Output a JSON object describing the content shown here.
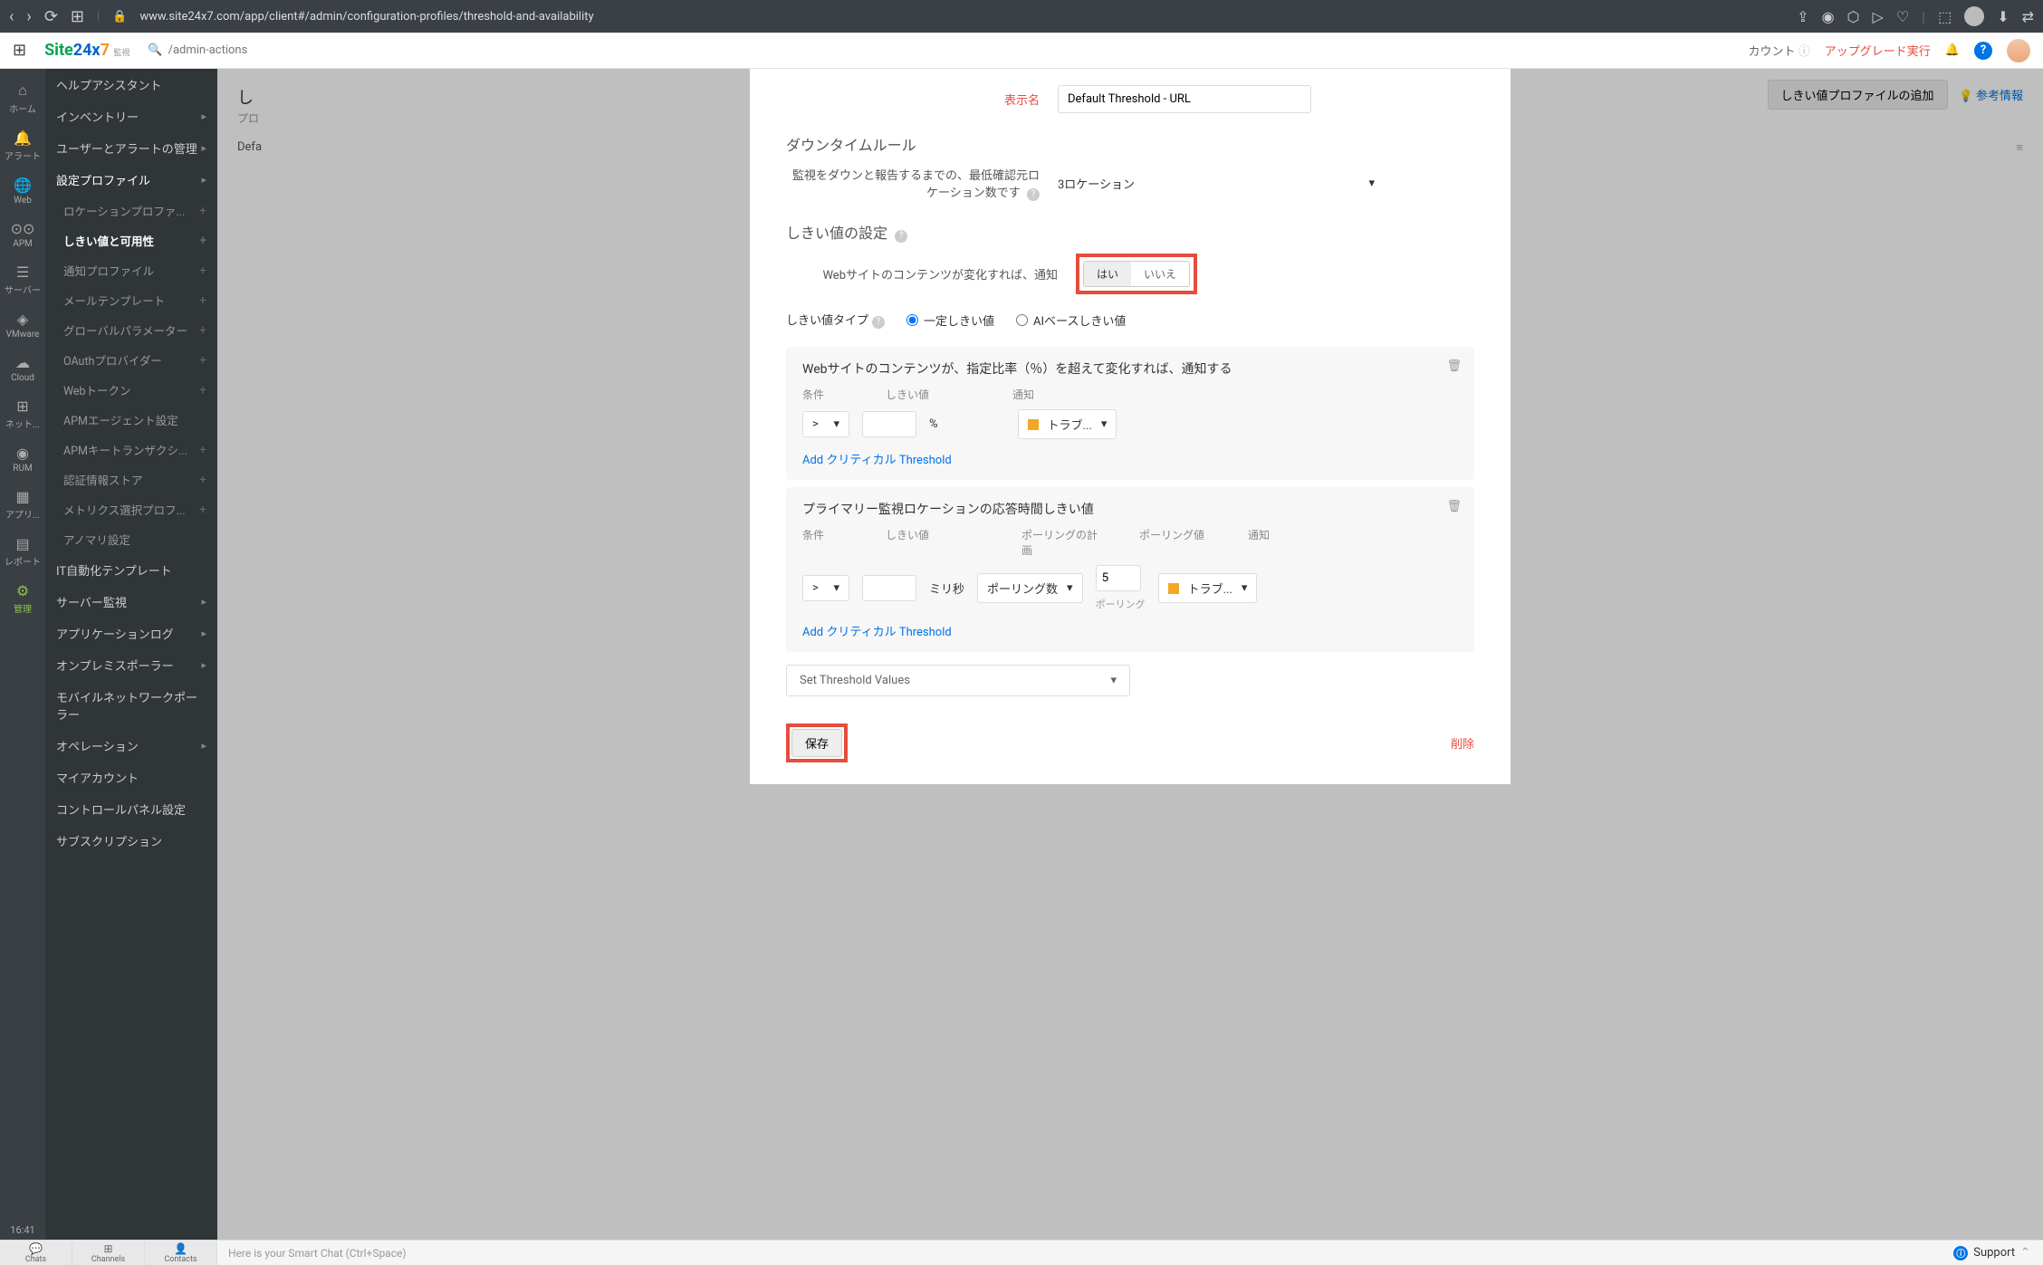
{
  "browser": {
    "url": "www.site24x7.com/app/client#/admin/configuration-profiles/threshold-and-availability"
  },
  "app": {
    "logo": "Site24x7",
    "search_placeholder": "/admin-actions",
    "account_label": "カウント",
    "upgrade_label": "アップグレード実行"
  },
  "rail": {
    "items": [
      {
        "icon": "⌂",
        "label": "ホーム"
      },
      {
        "icon": "🔔",
        "label": "アラート"
      },
      {
        "icon": "🌐",
        "label": "Web"
      },
      {
        "icon": "⊙⊙",
        "label": "APM"
      },
      {
        "icon": "☰",
        "label": "サーバー"
      },
      {
        "icon": "◈",
        "label": "VMware"
      },
      {
        "icon": "☁",
        "label": "Cloud"
      },
      {
        "icon": "⊞",
        "label": "ネット..."
      },
      {
        "icon": "◉",
        "label": "RUM"
      },
      {
        "icon": "▦",
        "label": "アプリ..."
      },
      {
        "icon": "▤",
        "label": "レポート"
      },
      {
        "icon": "⚙",
        "label": "管理"
      }
    ],
    "time": "16:41"
  },
  "sidebar": {
    "items": [
      {
        "label": "ヘルプアシスタント",
        "type": "item"
      },
      {
        "label": "インベントリー",
        "type": "item",
        "arrow": true
      },
      {
        "label": "ユーザーとアラートの管理",
        "type": "item",
        "arrow": true
      },
      {
        "label": "設定プロファイル",
        "type": "section",
        "arrow": true
      },
      {
        "label": "ロケーションプロファ...",
        "type": "sub",
        "plus": true
      },
      {
        "label": "しきい値と可用性",
        "type": "sub",
        "plus": true,
        "active": true
      },
      {
        "label": "通知プロファイル",
        "type": "sub",
        "plus": true
      },
      {
        "label": "メールテンプレート",
        "type": "sub",
        "plus": true
      },
      {
        "label": "グローバルパラメーター",
        "type": "sub",
        "plus": true
      },
      {
        "label": "OAuthプロバイダー",
        "type": "sub",
        "plus": true
      },
      {
        "label": "Webトークン",
        "type": "sub",
        "plus": true
      },
      {
        "label": "APMエージェント設定",
        "type": "sub"
      },
      {
        "label": "APMキートランザクシ...",
        "type": "sub",
        "plus": true
      },
      {
        "label": "認証情報ストア",
        "type": "sub",
        "plus": true
      },
      {
        "label": "メトリクス選択プロフ...",
        "type": "sub",
        "plus": true
      },
      {
        "label": "アノマリ設定",
        "type": "sub"
      },
      {
        "label": "IT自動化テンプレート",
        "type": "item"
      },
      {
        "label": "サーバー監視",
        "type": "item",
        "arrow": true
      },
      {
        "label": "アプリケーションログ",
        "type": "item",
        "arrow": true
      },
      {
        "label": "オンプレミスポーラー",
        "type": "item",
        "arrow": true
      },
      {
        "label": "モバイルネットワークポーラー",
        "type": "item"
      },
      {
        "label": "オペレーション",
        "type": "item",
        "arrow": true
      },
      {
        "label": "マイアカウント",
        "type": "item"
      },
      {
        "label": "コントロールパネル設定",
        "type": "item"
      },
      {
        "label": "サブスクリプション",
        "type": "item"
      }
    ]
  },
  "content": {
    "title": "し",
    "sub": "プロ",
    "row1": "Defa",
    "add_btn": "しきい値プロファイルの追加",
    "ref": "参考情報"
  },
  "modal": {
    "display_name_label": "表示名",
    "display_name_value": "Default Threshold - URL",
    "downtime_section": "ダウンタイムルール",
    "min_locations_label": "監視をダウンと報告するまでの、最低確認元ロケーション数です",
    "min_locations_value": "3ロケーション",
    "threshold_section": "しきい値の設定",
    "content_change_label": "Webサイトのコンテンツが変化すれば、通知",
    "toggle_yes": "はい",
    "toggle_no": "いいえ",
    "threshold_type_label": "しきい値タイプ",
    "radio_fixed": "一定しきい値",
    "radio_ai": "AIベースしきい値",
    "box1": {
      "title": "Webサイトのコンテンツが、指定比率（％）を超えて変化すれば、通知する",
      "col_cond": "条件",
      "col_th": "しきい値",
      "col_notif": "通知",
      "cond": ">",
      "unit": "%",
      "notif": "トラブ...",
      "add": "Add クリティカル Threshold"
    },
    "box2": {
      "title": "プライマリー監視ロケーションの応答時間しきい値",
      "col_cond": "条件",
      "col_th": "しきい値",
      "col_poll_plan": "ポーリングの計画",
      "col_poll_val": "ポーリング値",
      "col_notif": "通知",
      "cond": ">",
      "unit": "ミリ秒",
      "poll_plan": "ポーリング数",
      "poll_val": "5",
      "poll_sub": "ポーリング",
      "notif": "トラブ...",
      "add": "Add クリティカル Threshold"
    },
    "set_th": "Set Threshold Values",
    "save": "保存",
    "delete": "削除"
  },
  "bottom": {
    "tabs": [
      {
        "icon": "💬",
        "label": "Chats"
      },
      {
        "icon": "⊞",
        "label": "Channels"
      },
      {
        "icon": "👤",
        "label": "Contacts"
      }
    ],
    "smart_chat": "Here is your Smart Chat (Ctrl+Space)",
    "support": "Support"
  }
}
